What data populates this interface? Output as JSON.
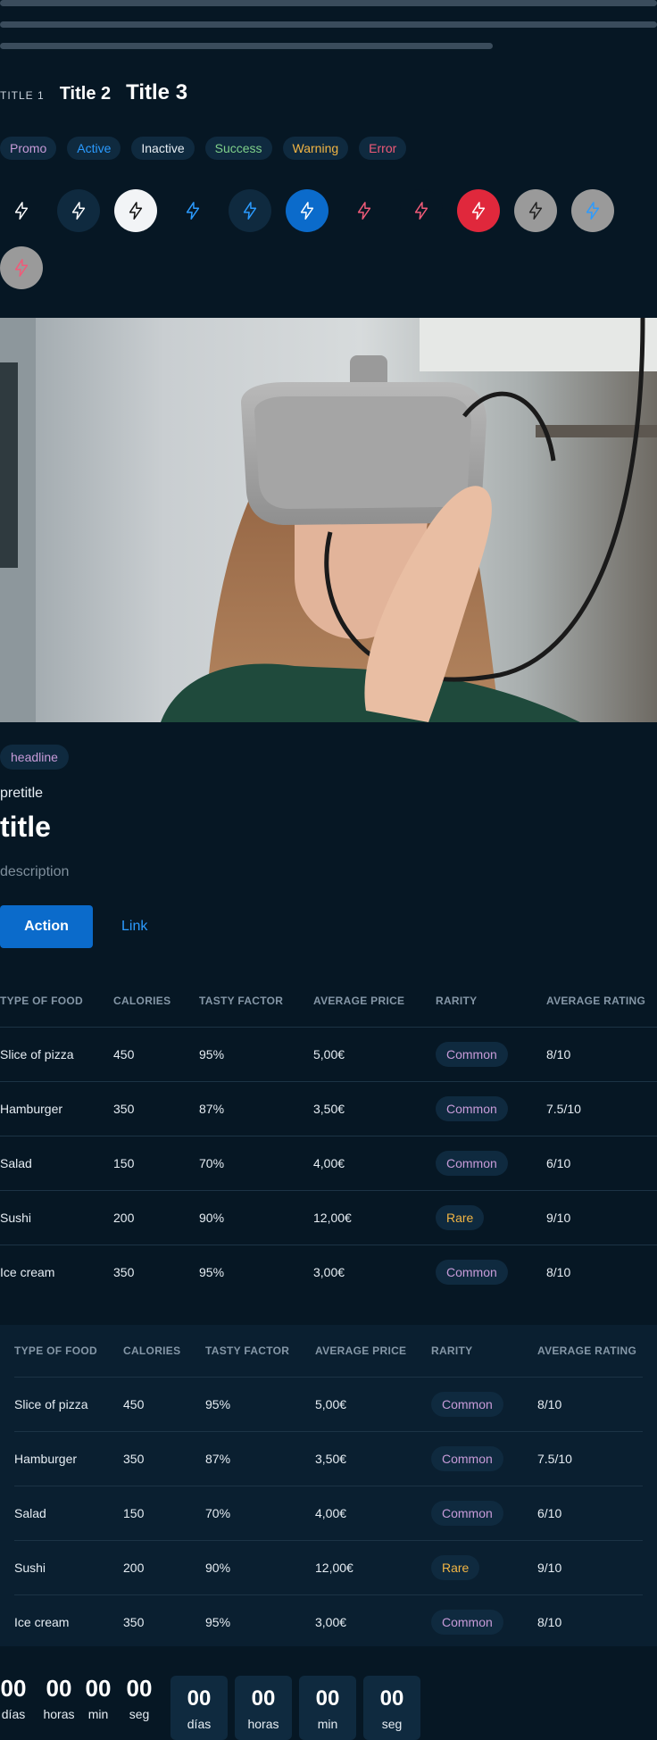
{
  "titles": {
    "t1": "TITLE 1",
    "t2": "Title 2",
    "t3": "Title 3"
  },
  "tags": [
    {
      "label": "Promo",
      "color": "#c79bd8"
    },
    {
      "label": "Active",
      "color": "#2b9bff"
    },
    {
      "label": "Inactive",
      "color": "#e6edf3"
    },
    {
      "label": "Success",
      "color": "#7fd08a"
    },
    {
      "label": "Warning",
      "color": "#f2b544"
    },
    {
      "label": "Error",
      "color": "#f05a78"
    }
  ],
  "icon_buttons": [
    {
      "icon": "bolt-icon",
      "color": "#ffffff",
      "bg": "transparent"
    },
    {
      "icon": "bolt-icon",
      "color": "#ffffff",
      "bg": "#0f2a3f"
    },
    {
      "icon": "bolt-icon",
      "color": "#111111",
      "bg": "#f2f4f6"
    },
    {
      "icon": "bolt-icon",
      "color": "#2b9bff",
      "bg": "transparent"
    },
    {
      "icon": "bolt-icon",
      "color": "#2b9bff",
      "bg": "#0f2a3f"
    },
    {
      "icon": "bolt-icon",
      "color": "#ffffff",
      "bg": "#0b6bcb"
    },
    {
      "icon": "bolt-icon",
      "color": "#f05a78",
      "bg": "transparent"
    },
    {
      "icon": "bolt-icon",
      "color": "#f05a78",
      "bg": "#061724"
    },
    {
      "icon": "bolt-icon",
      "color": "#ffffff",
      "bg": "#e0283c"
    },
    {
      "icon": "bolt-icon",
      "color": "#222222",
      "bg": "#9a9a9a"
    },
    {
      "icon": "bolt-icon",
      "color": "#2b9bff",
      "bg": "#9a9a9a"
    },
    {
      "icon": "bolt-icon",
      "color": "#f05a78",
      "bg": "#9a9a9a"
    }
  ],
  "card": {
    "headline": "headline",
    "pretitle": "pretitle",
    "title": "title",
    "description": "description",
    "action_label": "Action",
    "link_label": "Link"
  },
  "table": {
    "headers": [
      "TYPE OF FOOD",
      "CALORIES",
      "TASTY FACTOR",
      "AVERAGE PRICE",
      "RARITY",
      "AVERAGE RATING"
    ],
    "rows": [
      [
        "Slice of pizza",
        "450",
        "95%",
        "5,00€",
        "Common",
        "8/10"
      ],
      [
        "Hamburger",
        "350",
        "87%",
        "3,50€",
        "Common",
        "7.5/10"
      ],
      [
        "Salad",
        "150",
        "70%",
        "4,00€",
        "Common",
        "6/10"
      ],
      [
        "Sushi",
        "200",
        "90%",
        "12,00€",
        "Rare",
        "9/10"
      ],
      [
        "Ice cream",
        "350",
        "95%",
        "3,00€",
        "Common",
        "8/10"
      ]
    ]
  },
  "countdown": {
    "values": [
      "00",
      "00",
      "00",
      "00"
    ],
    "labels": [
      "días",
      "horas",
      "min",
      "seg"
    ]
  }
}
